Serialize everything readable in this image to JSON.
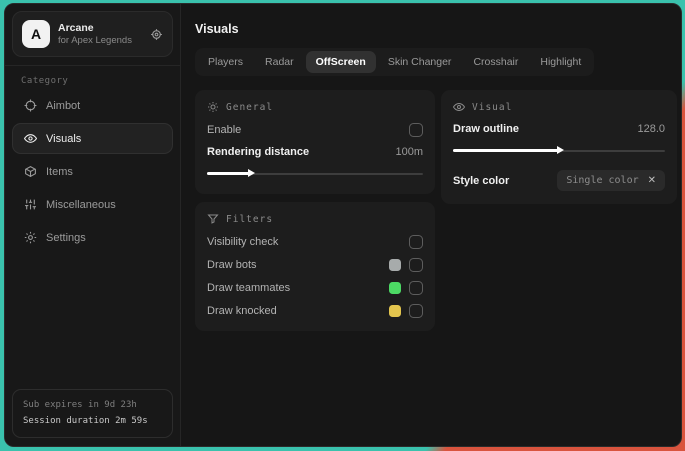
{
  "app": {
    "logo_letter": "A",
    "name": "Arcane",
    "subtitle": "for Apex Legends"
  },
  "sidebar": {
    "category_label": "Category",
    "items": [
      {
        "label": "Aimbot"
      },
      {
        "label": "Visuals"
      },
      {
        "label": "Items"
      },
      {
        "label": "Miscellaneous"
      },
      {
        "label": "Settings"
      }
    ],
    "footer": {
      "line1": "Sub expires in 9d 23h",
      "line2": "Session duration 2m 59s"
    }
  },
  "header": {
    "title": "Visuals"
  },
  "tabs": {
    "items": [
      {
        "label": "Players"
      },
      {
        "label": "Radar"
      },
      {
        "label": "OffScreen"
      },
      {
        "label": "Skin Changer"
      },
      {
        "label": "Crosshair"
      },
      {
        "label": "Highlight"
      }
    ],
    "active": "OffScreen"
  },
  "panels": {
    "general": {
      "title": "General",
      "enable_label": "Enable",
      "enable_checked": false,
      "rendering_label": "Rendering distance",
      "rendering_value": "100m",
      "slider_fill": "20%"
    },
    "visual": {
      "title": "Visual",
      "draw_outline_label": "Draw outline",
      "draw_outline_value": "128.0",
      "slider_fill": "50%",
      "style_color_label": "Style color",
      "style_color_value": "Single color",
      "style_color_close": "✕"
    },
    "filters": {
      "title": "Filters",
      "rows": [
        {
          "label": "Visibility check",
          "swatch": "",
          "checked": false
        },
        {
          "label": "Draw bots",
          "swatch": "#a7abab",
          "checked": false
        },
        {
          "label": "Draw teammates",
          "swatch": "#4cd964",
          "checked": false
        },
        {
          "label": "Draw knocked",
          "swatch": "#e3c54e",
          "checked": false
        }
      ]
    }
  },
  "colors": {
    "background_teal": "#3ac2ad",
    "background_red": "#d9543e",
    "window_bg": "#161616",
    "panel_bg": "#1d1d1d",
    "swatch_gray": "#a7abab",
    "swatch_green": "#4cd964",
    "swatch_yellow": "#e3c54e"
  }
}
